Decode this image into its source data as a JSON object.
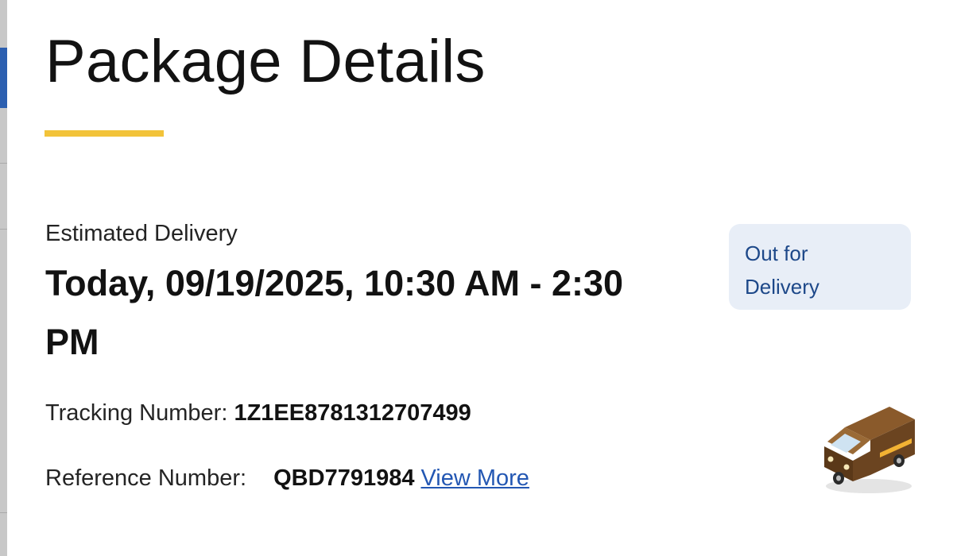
{
  "header": {
    "title": "Package Details"
  },
  "delivery": {
    "estimated_label": "Estimated Delivery",
    "estimated_value": "Today, 09/19/2025, 10:30 AM - 2:30 PM",
    "status": "Out for Delivery"
  },
  "tracking": {
    "label": "Tracking Number:",
    "value": "1Z1EE8781312707499"
  },
  "reference": {
    "label": "Reference Number:",
    "value": "QBD7791984",
    "link": "View More"
  },
  "icons": {
    "truck": "delivery-truck-icon"
  },
  "colors": {
    "accent_underline": "#f2c33a",
    "status_bg": "#e8eef7",
    "status_text": "#1d4889",
    "link": "#2357b3",
    "truck_body": "#6b4420",
    "truck_stripe": "#f2b233"
  }
}
